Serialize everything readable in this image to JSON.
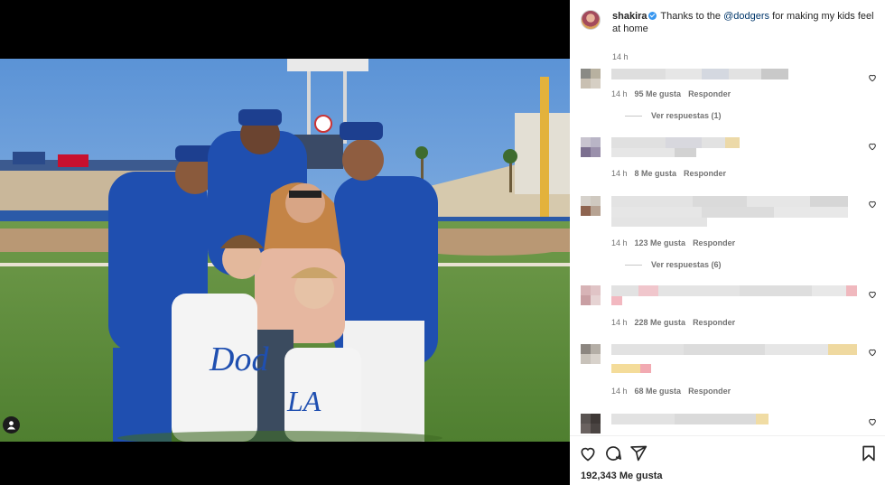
{
  "post": {
    "username": "shakira",
    "caption_prefix": "Thanks to the ",
    "mention": "@dodgers",
    "caption_suffix": " for making my kids feel at home",
    "time": "14 h",
    "likes": "192,343 Me gusta"
  },
  "comments": [
    {
      "time": "14 h",
      "likes": "95 Me gusta",
      "reply": "Responder",
      "view_replies": "Ver respuestas (1)"
    },
    {
      "time": "14 h",
      "likes": "8 Me gusta",
      "reply": "Responder"
    },
    {
      "time": "14 h",
      "likes": "123 Me gusta",
      "reply": "Responder",
      "view_replies": "Ver respuestas (6)"
    },
    {
      "time": "14 h",
      "likes": "228 Me gusta",
      "reply": "Responder"
    },
    {
      "time": "14 h",
      "likes": "68 Me gusta",
      "reply": "Responder"
    }
  ],
  "icons": {
    "like": "heart-icon",
    "comment": "comment-icon",
    "share": "share-icon",
    "save": "bookmark-icon",
    "tag": "user-tag-icon",
    "verified": "verified-badge-icon"
  },
  "colors": {
    "mention": "#00376b",
    "verified": "#3897f0",
    "secondary_text": "#737373"
  }
}
